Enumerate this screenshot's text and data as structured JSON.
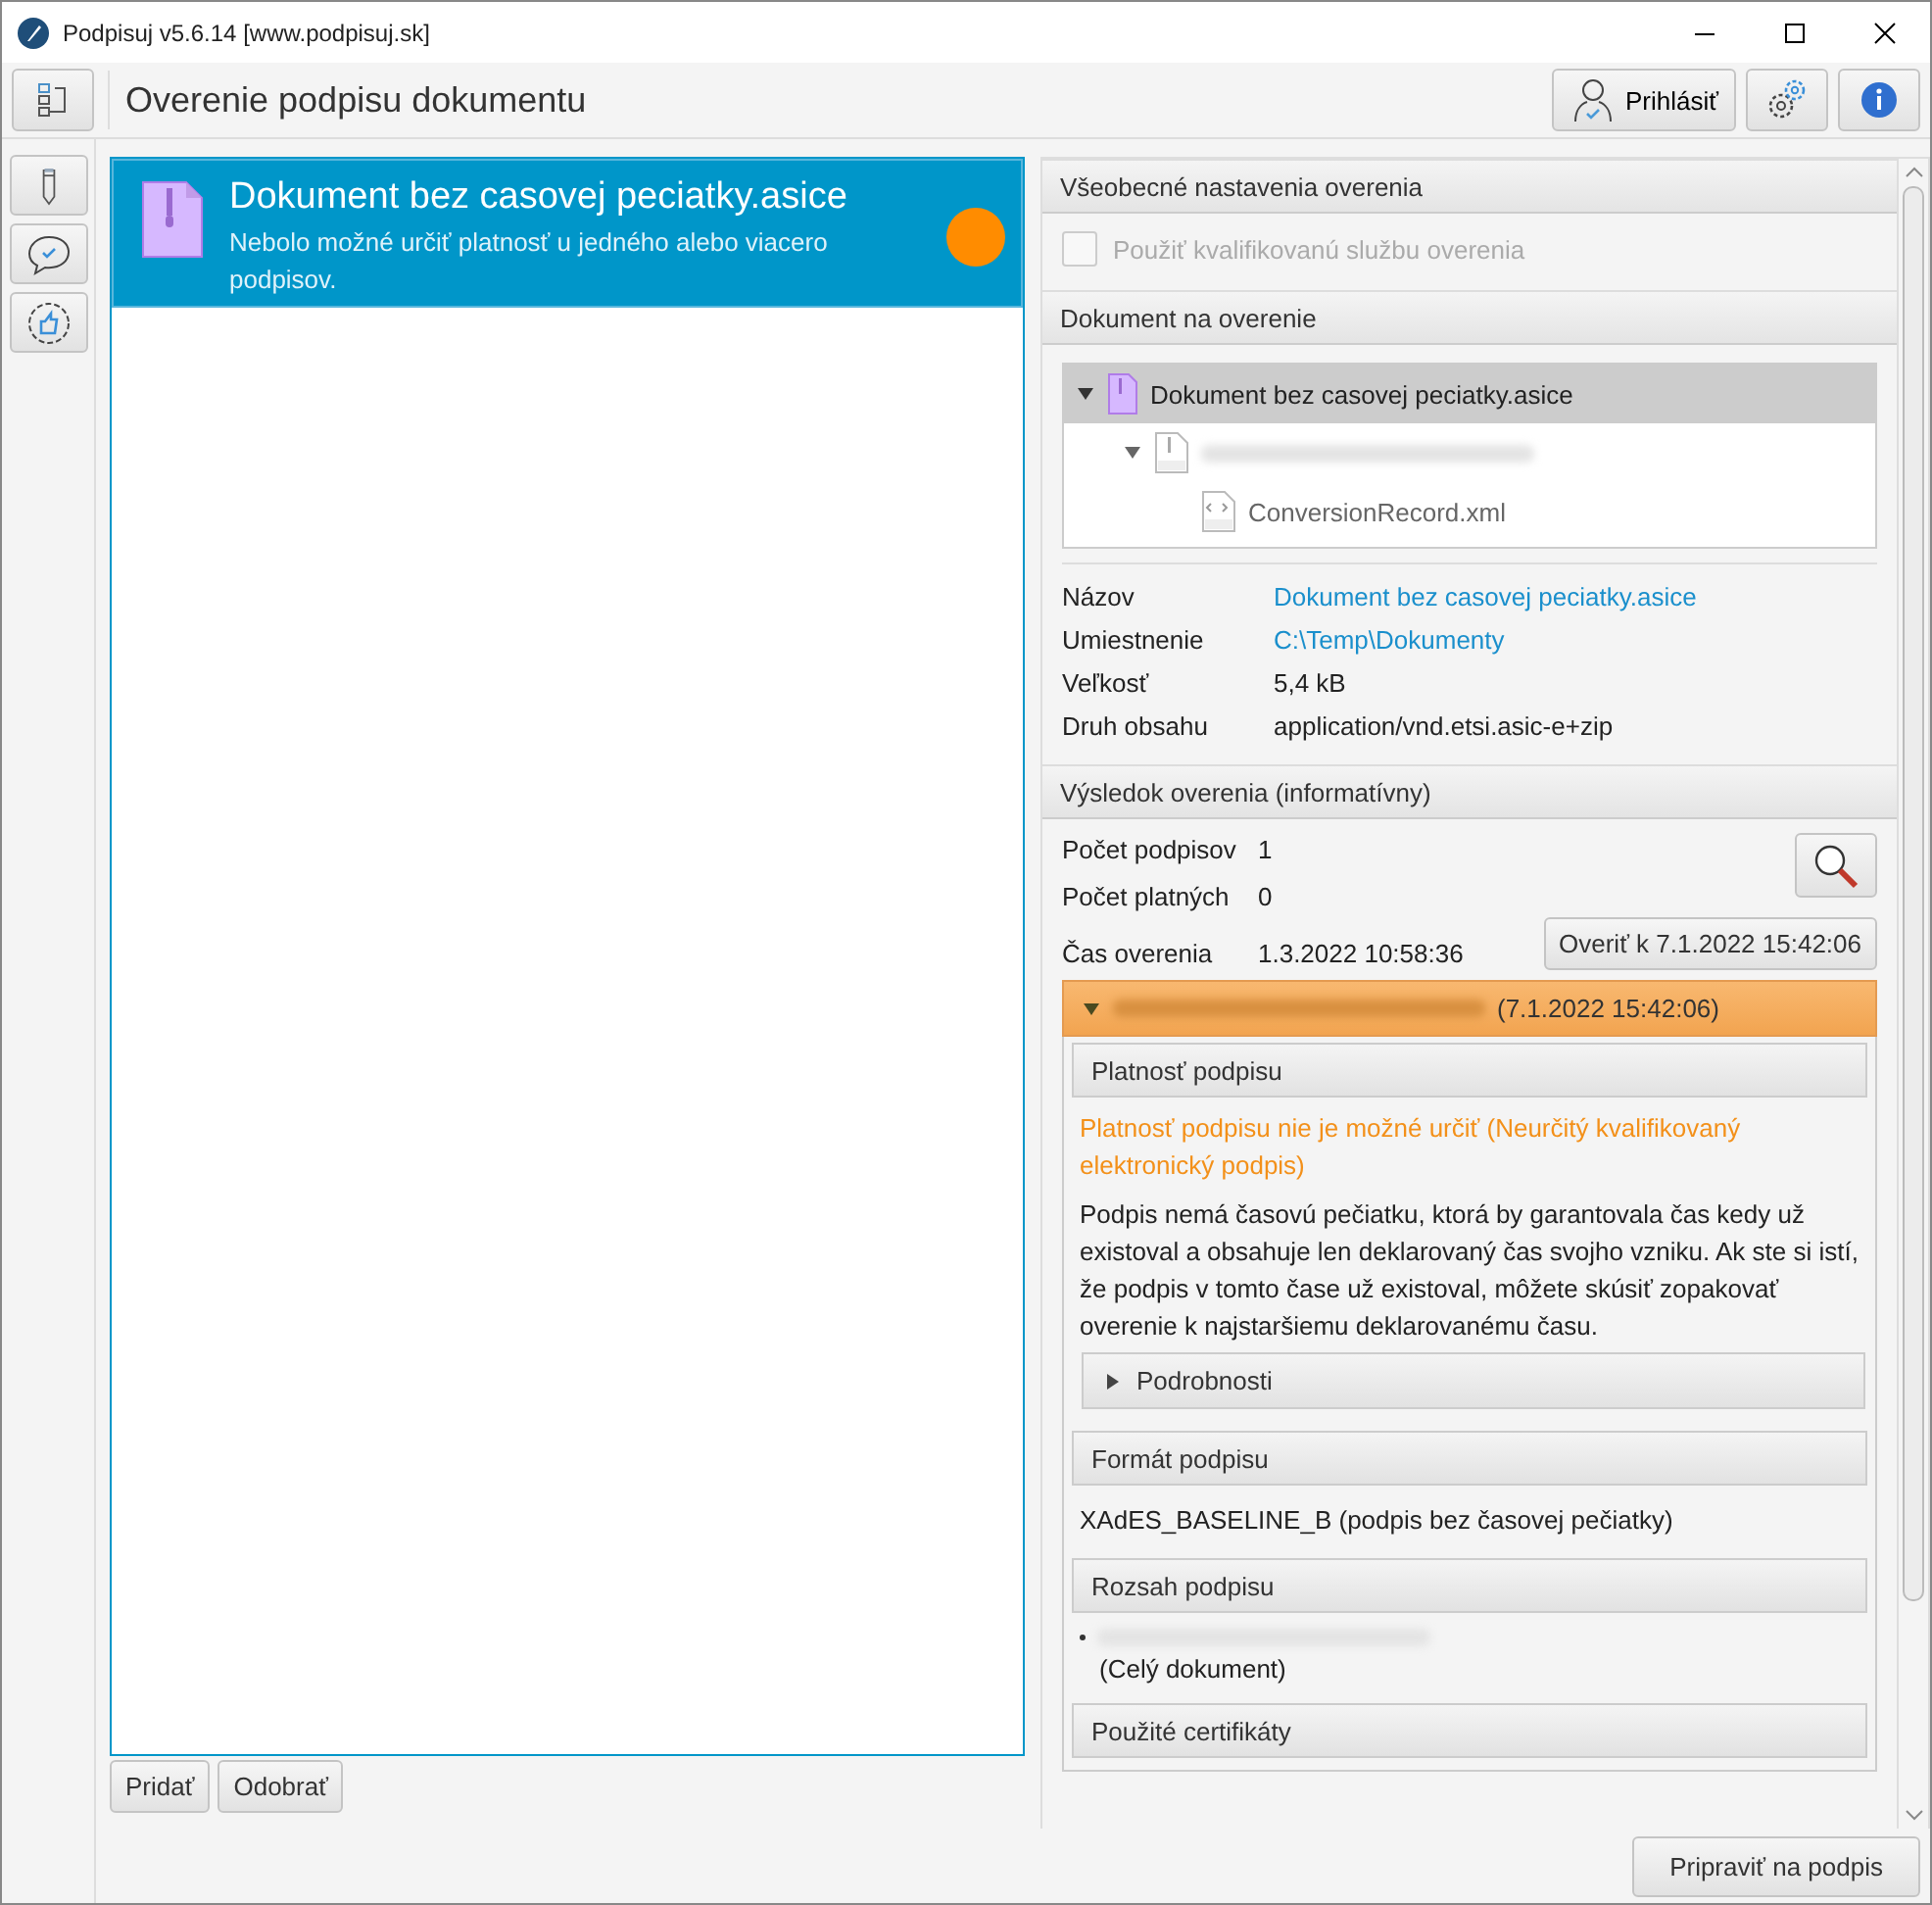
{
  "window": {
    "title": "Podpisuj v5.6.14 [www.podpisuj.sk]"
  },
  "toolbar": {
    "title": "Overenie podpisu dokumentu",
    "login_button": "Prihlásiť"
  },
  "documents": [
    {
      "name": "Dokument bez casovej peciatky.asice",
      "message": "Nebolo možné určiť platnosť u jedného alebo viacero podpisov.",
      "selected": true,
      "color": "#ff8c00"
    }
  ],
  "list_buttons": [
    "Pridať",
    "Odobrať"
  ],
  "general_settings": {
    "title": "Všeobecné nastavenia overenia",
    "checkbox": {
      "label": "Použiť kvalifikovanú službu overenia",
      "checked": false,
      "disabled": true
    }
  },
  "document_section": {
    "title": "Dokument na overenie",
    "tree": [
      {
        "kind": "archive",
        "name": "Dokument bez casovej peciatky.asice",
        "selected": true,
        "expanded": true,
        "children": [
          {
            "kind": "redacted",
            "selected": false,
            "expanded": true,
            "children": [
              {
                "kind": "xml",
                "name": "ConversionRecord.xml",
                "selected": false
              }
            ]
          }
        ]
      }
    ],
    "properties": [
      {
        "label": "Názov",
        "value": "Dokument bez casovej peciatky.asice",
        "kind": "link"
      },
      {
        "label": "Umiestnenie",
        "value": "C:\\Temp\\Dokumenty",
        "kind": "link"
      },
      {
        "label": "Veľkosť",
        "value": "5,4 kB",
        "kind": "text"
      },
      {
        "label": "Druh obsahu",
        "value": "application/vnd.etsi.asic-e+zip",
        "kind": "text"
      }
    ]
  },
  "result": {
    "title": "Výsledok overenia (informatívny)",
    "stats": [
      {
        "label": "Počet podpisov",
        "value": "1"
      },
      {
        "label": "Počet platných",
        "value": "0"
      },
      {
        "label": "Čas overenia",
        "value": "1.3.2022 10:58:36"
      }
    ],
    "verify_button": "Overiť k 7.1.2022 15:42:06",
    "signature": {
      "time": "(7.1.2022 15:42:06)",
      "expanded": true,
      "validity": {
        "title": "Platnosť podpisu",
        "status": "Platnosť podpisu nie je možné určiť (Neurčitý kvalifikovaný elektronický podpis)",
        "description": "Podpis nemá časovú pečiatku, ktorá by garantovala čas kedy už existoval a obsahuje len deklarovaný čas svojho vzniku. Ak ste si istí, že podpis v tomto čase už existoval, môžete skúsiť zopakovať overenie k najstaršiemu deklarovanému času.",
        "details": {
          "label": "Podrobnosti",
          "expanded": false
        }
      },
      "format": {
        "title": "Formát podpisu",
        "value": "XAdES_BASELINE_B (podpis bez časovej pečiatky)"
      },
      "scope": {
        "title": "Rozsah podpisu",
        "note": "(Celý dokument)"
      },
      "certificates": {
        "title": "Použité certifikáty"
      }
    }
  },
  "prepare_button": "Pripraviť na podpis"
}
